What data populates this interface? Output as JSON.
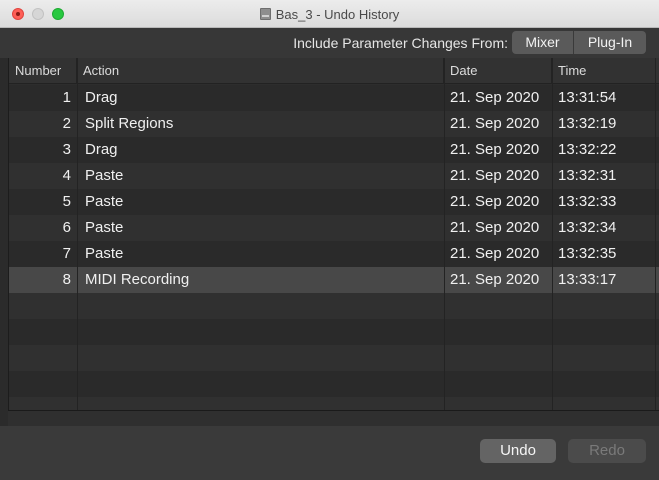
{
  "window": {
    "title": "Bas_3 - Undo History"
  },
  "toolbar": {
    "include_label": "Include Parameter Changes From:",
    "mixer_label": "Mixer",
    "plugin_label": "Plug-In"
  },
  "table": {
    "columns": [
      "Number",
      "Action",
      "Date",
      "Time"
    ],
    "rows": [
      {
        "number": "1",
        "action": "Drag",
        "date": "21. Sep 2020",
        "time": "13:31:54"
      },
      {
        "number": "2",
        "action": "Split Regions",
        "date": "21. Sep 2020",
        "time": "13:32:19"
      },
      {
        "number": "3",
        "action": "Drag",
        "date": "21. Sep 2020",
        "time": "13:32:22"
      },
      {
        "number": "4",
        "action": "Paste",
        "date": "21. Sep 2020",
        "time": "13:32:31"
      },
      {
        "number": "5",
        "action": "Paste",
        "date": "21. Sep 2020",
        "time": "13:32:33"
      },
      {
        "number": "6",
        "action": "Paste",
        "date": "21. Sep 2020",
        "time": "13:32:34"
      },
      {
        "number": "7",
        "action": "Paste",
        "date": "21. Sep 2020",
        "time": "13:32:35"
      },
      {
        "number": "8",
        "action": "MIDI Recording",
        "date": "21. Sep 2020",
        "time": "13:33:17"
      }
    ],
    "selected_row": 8
  },
  "footer": {
    "undo_label": "Undo",
    "redo_label": "Redo"
  },
  "colors": {
    "close": "#fe5f57",
    "minimize_inactive": "#d6d6d6",
    "maximize": "#28c840"
  }
}
